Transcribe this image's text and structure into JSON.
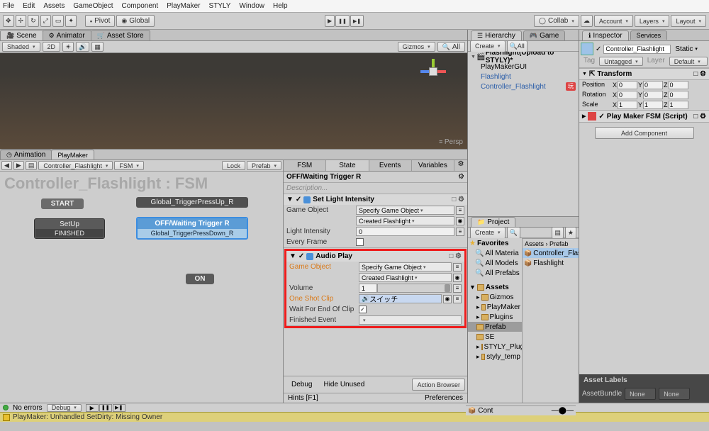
{
  "menu": [
    "File",
    "Edit",
    "Assets",
    "GameObject",
    "Component",
    "PlayMaker",
    "STYLY",
    "Window",
    "Help"
  ],
  "topbar": {
    "pivot": "Pivot",
    "global": "Global",
    "collab": "Collab",
    "account": "Account",
    "layers": "Layers",
    "layout": "Layout"
  },
  "sceneTabs": {
    "scene": "Scene",
    "animator": "Animator",
    "assetStore": "Asset Store"
  },
  "sceneBar": {
    "shaded": "Shaded",
    "mode2d": "2D",
    "gizmos": "Gizmos",
    "all": "All"
  },
  "persp": "Persp",
  "animTabs": {
    "animation": "Animation",
    "playmaker": "PlayMaker"
  },
  "fsmToolbar": {
    "obj": "Controller_Flashlight",
    "fsm": "FSM",
    "lock": "Lock",
    "prefab": "Prefab"
  },
  "fsmTitle": "Controller_Flashlight : FSM",
  "nodes": {
    "start": "START",
    "setup": "SetUp",
    "setupSub": "FINISHED",
    "global": "Global_TriggerPressUp_R",
    "off": "OFF/Waiting Trigger R",
    "offSub": "Global_TriggerPressDown_R",
    "on": "ON"
  },
  "fsmPanel": {
    "tabs": {
      "fsm": "FSM",
      "state": "State",
      "events": "Events",
      "variables": "Variables"
    },
    "stateName": "OFF/Waiting Trigger R",
    "desc": "Description...",
    "a1": {
      "title": "Set Light Intensity",
      "gameObject": "Game Object",
      "goVal": "Specify Game Object",
      "goObj": "Created Flashlight",
      "lightIntensity": "Light Intensity",
      "liVal": "0",
      "everyFrame": "Every Frame"
    },
    "a2": {
      "title": "Audio Play",
      "gameObject": "Game Object",
      "goVal": "Specify Game Object",
      "goObj": "Created Flashlight",
      "volume": "Volume",
      "volVal": "1",
      "oneShot": "One Shot Clip",
      "oneShotVal": "スイッチ",
      "wait": "Wait For End Of Clip",
      "finished": "Finished Event"
    },
    "debug": "Debug",
    "hideUnused": "Hide Unused",
    "actionBrowser": "Action Browser",
    "hints": "Hints [F1]",
    "prefs": "Preferences"
  },
  "hierarchy": {
    "title": "Hierarchy",
    "game": "Game",
    "create": "Create",
    "scene": "Flashlight(Upload to STYLY)*",
    "items": [
      "PlayMakerGUI",
      "Flashlight",
      "Controller_Flashlight"
    ],
    "badge": "玩"
  },
  "project": {
    "title": "Project",
    "create": "Create",
    "fav": "Favorites",
    "favs": [
      "All Materia",
      "All Models",
      "All Prefabs"
    ],
    "assets": "Assets",
    "tree": [
      "Gizmos",
      "PlayMaker",
      "Plugins",
      "Prefab",
      "SE",
      "STYLY_Plug",
      "styly_temp"
    ],
    "crumb": "Assets  ›  Prefab",
    "items": [
      "Controller_Flas",
      "Flashlight"
    ],
    "footer": "Cont"
  },
  "inspector": {
    "title": "Inspector",
    "services": "Services",
    "name": "Controller_Flashlight",
    "static": "Static",
    "tag": "Tag",
    "tagVal": "Untagged",
    "layer": "Layer",
    "layerVal": "Default",
    "transform": "Transform",
    "position": "Position",
    "rotation": "Rotation",
    "scale": "Scale",
    "px": "0",
    "py": "0",
    "pz": "0",
    "rx": "0",
    "ry": "0",
    "rz": "0",
    "sx": "1",
    "sy": "1",
    "sz": "1",
    "pm": "Play Maker FSM (Script)",
    "addComponent": "Add Component",
    "assetLabels": "Asset Labels",
    "assetBundle": "AssetBundle",
    "none": "None"
  },
  "status": {
    "noErrors": "No errors",
    "debug": "Debug",
    "warn": "PlayMaker: Unhandled SetDirty: Missing Owner"
  }
}
